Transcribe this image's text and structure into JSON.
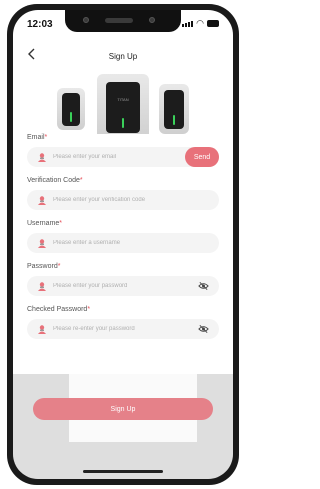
{
  "status_bar": {
    "time": "12:03"
  },
  "header": {
    "title": "Sign Up"
  },
  "hero": {
    "brand_text": "TITAN"
  },
  "form": {
    "email": {
      "label": "Email",
      "placeholder": "Please enter your email",
      "send_label": "Send"
    },
    "verification": {
      "label": "Verification Code",
      "placeholder": "Please enter your verification code"
    },
    "username": {
      "label": "Username",
      "placeholder": "Please enter a username"
    },
    "password": {
      "label": "Password",
      "placeholder": "Please enter your password"
    },
    "checked_password": {
      "label": "Checked Password",
      "placeholder": "Please re-enter your password"
    },
    "required_mark": "*"
  },
  "actions": {
    "signup_label": "Sign Up"
  },
  "icons": {
    "back": "chevron-left-icon",
    "field": "user-icon",
    "visibility": "eye-off-icon"
  },
  "colors": {
    "accent": "#e8717a",
    "signup_button": "#e58189",
    "input_bg": "#f4f4f4",
    "required": "#e64b55"
  }
}
